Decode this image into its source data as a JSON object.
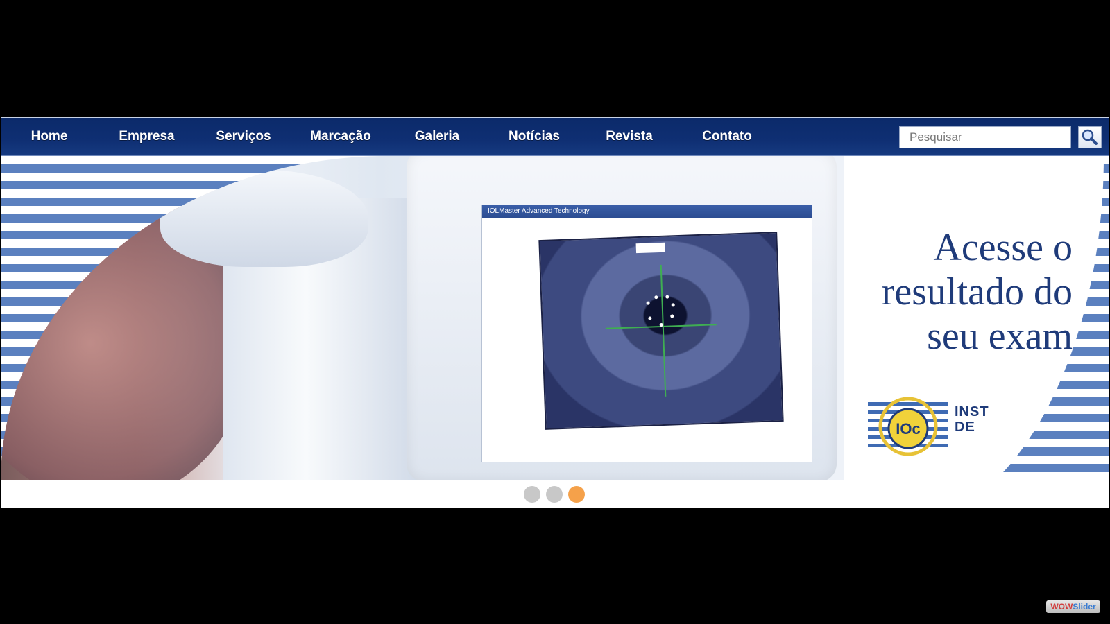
{
  "nav": {
    "items": [
      {
        "label": "Home"
      },
      {
        "label": "Empresa"
      },
      {
        "label": "Serviços"
      },
      {
        "label": "Marcação"
      },
      {
        "label": "Galeria"
      },
      {
        "label": "Notícias"
      },
      {
        "label": "Revista"
      },
      {
        "label": "Contato"
      }
    ],
    "search_placeholder": "Pesquisar",
    "search_icon": "search-icon"
  },
  "banner": {
    "headline_line1": "Acesse o",
    "headline_line2": "resultado do",
    "headline_line3": "seu exam",
    "logo_mark": "IOc",
    "logo_text_line1": "INST",
    "logo_text_line2": "DE",
    "screen_title": "IOLMaster Advanced Technology"
  },
  "slider": {
    "slide_count": 3,
    "active_index": 3
  },
  "badge": {
    "part1": "WOW",
    "part2": "Slider"
  },
  "colors": {
    "nav_bg": "#0f2f73",
    "stripe_blue": "#5b80bf",
    "headline": "#1f3b7a",
    "active_dot": "#f5a14a"
  }
}
